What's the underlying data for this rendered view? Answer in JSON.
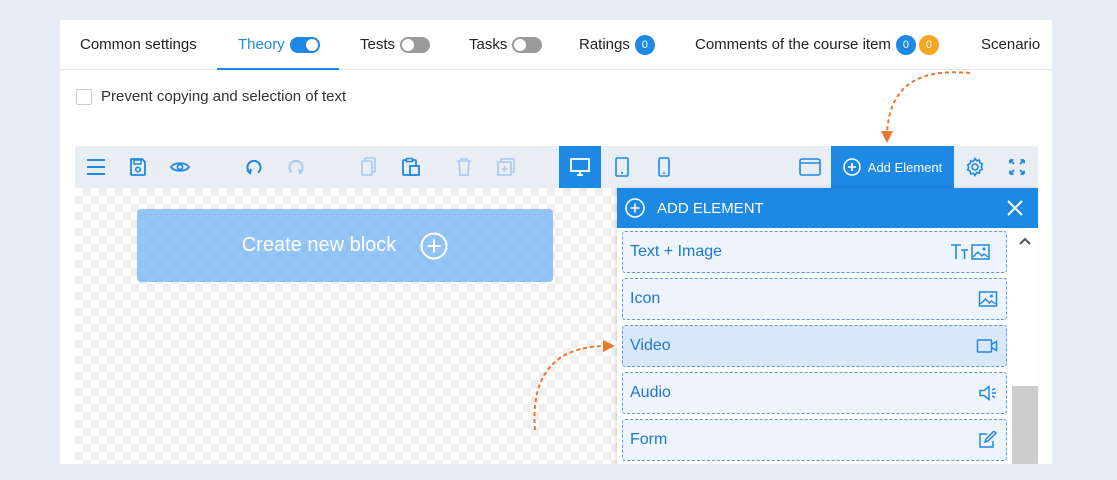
{
  "tabs": {
    "common_settings": "Common settings",
    "theory": {
      "label": "Theory",
      "toggle_on": true
    },
    "tests": {
      "label": "Tests",
      "toggle_on": false
    },
    "tasks": {
      "label": "Tasks",
      "toggle_on": false
    },
    "ratings": {
      "label": "Ratings",
      "badge": "0"
    },
    "comments": {
      "label": "Comments of the course item",
      "badge_blue": "0",
      "badge_orange": "0"
    },
    "scenario": "Scenario"
  },
  "prevent_copying": {
    "label": "Prevent copying and selection of text",
    "checked": false
  },
  "toolbar": {
    "icons": [
      "menu-icon",
      "save-icon",
      "preview-eye-icon",
      "undo-icon",
      "redo-icon",
      "copy-icon",
      "paste-icon",
      "delete-icon",
      "duplicate-icon",
      "desktop-icon",
      "tablet-icon",
      "mobile-icon",
      "window-icon",
      "settings-gear-icon",
      "fullscreen-icon"
    ],
    "active_device": "desktop",
    "add_element_label": "Add Element"
  },
  "canvas": {
    "create_block_label": "Create new block"
  },
  "add_element_panel": {
    "title": "ADD ELEMENT",
    "items": [
      {
        "label": "Text + Image",
        "icon": "text-image-icon"
      },
      {
        "label": "Icon",
        "icon": "image-icon"
      },
      {
        "label": "Video",
        "icon": "video-icon",
        "highlighted": true
      },
      {
        "label": "Audio",
        "icon": "audio-speaker-icon"
      },
      {
        "label": "Form",
        "icon": "edit-form-icon"
      }
    ]
  },
  "colors": {
    "accent": "#1e88e5",
    "badge_orange": "#f5a623",
    "arrow_orange": "#e8782a",
    "page_bg": "#e6edf7",
    "toolbar_bg": "#e9eef5"
  }
}
